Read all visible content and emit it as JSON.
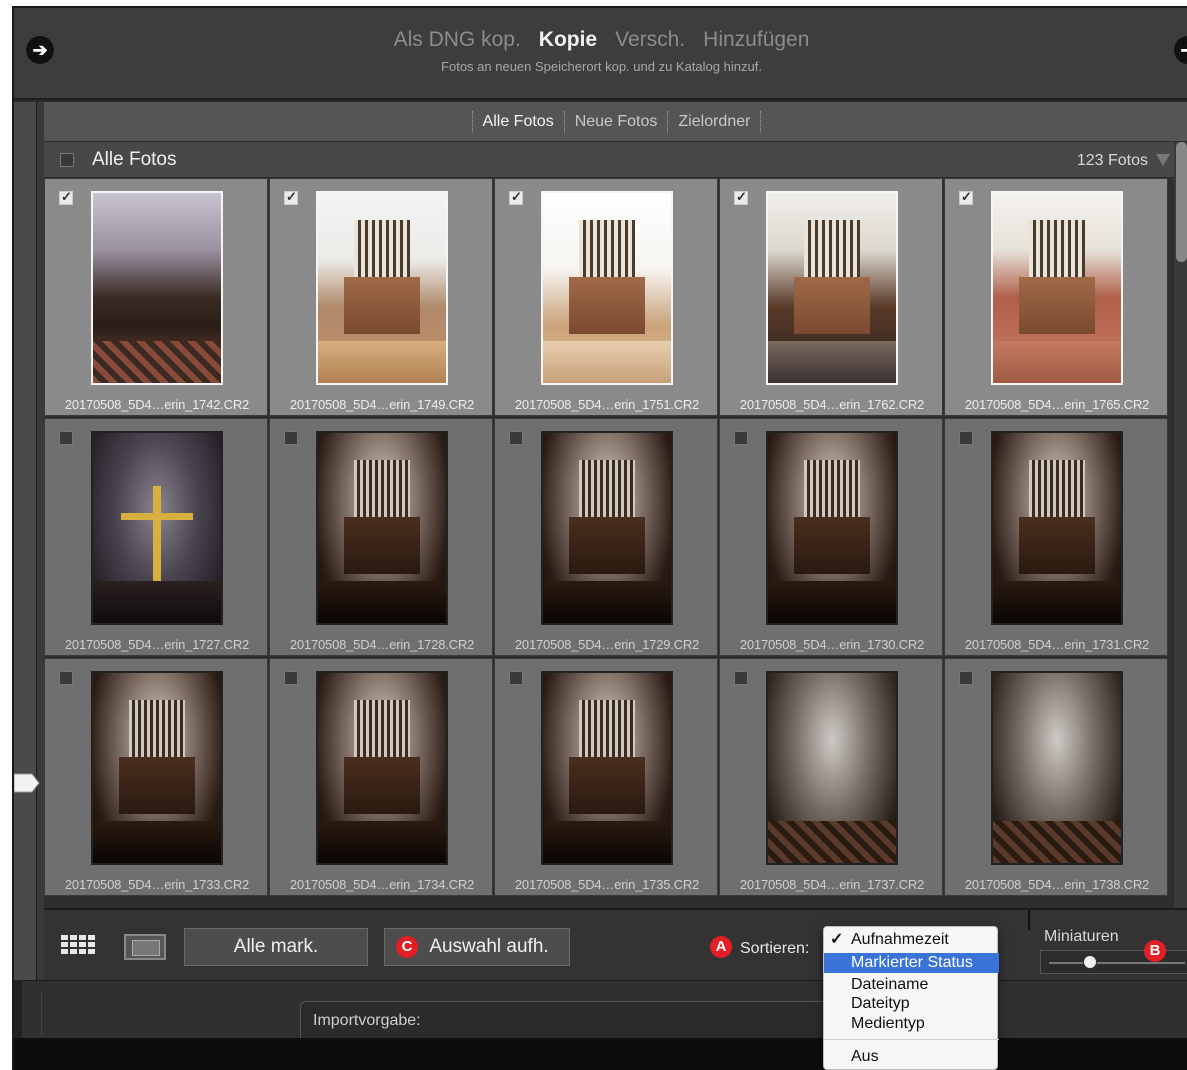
{
  "header": {
    "modes": [
      {
        "label": "Als DNG kop.",
        "active": false
      },
      {
        "label": "Kopie",
        "active": true
      },
      {
        "label": "Versch.",
        "active": false
      },
      {
        "label": "Hinzufügen",
        "active": false
      }
    ],
    "subtitle": "Fotos an neuen Speicherort kop. und zu Katalog hinzuf.",
    "left_nav_icon": "arrow-right-icon",
    "right_nav_icon": "arrow-left-icon"
  },
  "source_tabs": [
    {
      "label": "Alle Fotos",
      "active": true
    },
    {
      "label": "Neue Fotos",
      "active": false
    },
    {
      "label": "Zielordner",
      "active": false
    }
  ],
  "grid_header": {
    "title": "Alle Fotos",
    "count": "123 Fotos",
    "checked": false
  },
  "photos": [
    {
      "name": "20170508_5D4…erin_1742.CR2",
      "checked": true,
      "style": "nave-bright"
    },
    {
      "name": "20170508_5D4…erin_1749.CR2",
      "checked": true,
      "style": "organ-bright"
    },
    {
      "name": "20170508_5D4…erin_1751.CR2",
      "checked": true,
      "style": "organ-white"
    },
    {
      "name": "20170508_5D4…erin_1762.CR2",
      "checked": true,
      "style": "organ-chandelier"
    },
    {
      "name": "20170508_5D4…erin_1765.CR2",
      "checked": true,
      "style": "organ-closeup"
    },
    {
      "name": "20170508_5D4…erin_1727.CR2",
      "checked": false,
      "style": "cross-dark"
    },
    {
      "name": "20170508_5D4…erin_1728.CR2",
      "checked": false,
      "style": "organ-dark"
    },
    {
      "name": "20170508_5D4…erin_1729.CR2",
      "checked": false,
      "style": "organ-dark"
    },
    {
      "name": "20170508_5D4…erin_1730.CR2",
      "checked": false,
      "style": "organ-dark"
    },
    {
      "name": "20170508_5D4…erin_1731.CR2",
      "checked": false,
      "style": "organ-dark"
    },
    {
      "name": "20170508_5D4…erin_1733.CR2",
      "checked": false,
      "style": "organ-dark"
    },
    {
      "name": "20170508_5D4…erin_1734.CR2",
      "checked": false,
      "style": "organ-dark"
    },
    {
      "name": "20170508_5D4…erin_1735.CR2",
      "checked": false,
      "style": "organ-dark"
    },
    {
      "name": "20170508_5D4…erin_1737.CR2",
      "checked": false,
      "style": "nave-dark"
    },
    {
      "name": "20170508_5D4…erin_1738.CR2",
      "checked": false,
      "style": "nave-dark"
    }
  ],
  "toolbar": {
    "grid_view_icon": "grid-view-icon",
    "loupe_view_icon": "loupe-view-icon",
    "select_all_label": "Alle mark.",
    "deselect_label": "Auswahl aufh.",
    "sort_label": "Sortieren:",
    "thumbnails_label": "Miniaturen",
    "thumbnail_size": 0.3
  },
  "annotations": {
    "a": "A",
    "b": "B",
    "c": "C",
    "color": "#e31e24"
  },
  "sort_menu": {
    "items": [
      {
        "label": "Aufnahmezeit",
        "checked": true,
        "highlighted": false
      },
      {
        "label": "Markierter Status",
        "checked": false,
        "highlighted": true
      },
      {
        "label": "Dateiname",
        "checked": false,
        "highlighted": false
      },
      {
        "label": "Dateityp",
        "checked": false,
        "highlighted": false
      },
      {
        "label": "Medientyp",
        "checked": false,
        "highlighted": false
      },
      {
        "label": "Aus",
        "checked": false,
        "highlighted": false
      }
    ],
    "check_glyph": "✓",
    "highlight_color": "#3b74d9"
  },
  "import_preset": {
    "label": "Importvorgabe:"
  }
}
